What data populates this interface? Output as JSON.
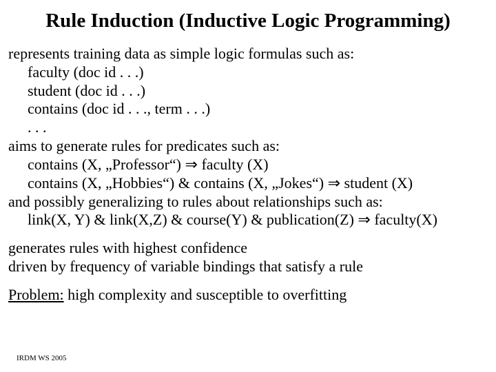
{
  "title": "Rule Induction (Inductive Logic Programming)",
  "l1": "represents training data as simple logic formulas such as:",
  "l2": "faculty (doc id . . .)",
  "l3": "student (doc id . . .)",
  "l4": "contains (doc id . . ., term . . .)",
  "l5": ". . .",
  "l6": "aims to generate rules for predicates such as:",
  "l7a": "contains (X, „Professor“) ",
  "l7b": " faculty (X)",
  "l8a": "contains (X, „Hobbies“) & contains (X, „Jokes“) ",
  "l8b": " student (X)",
  "l9": "and possibly generalizing to rules about relationships such as:",
  "l10a": "link(X, Y) & link(X,Z) & course(Y) & publication(Z) ",
  "l10b": "  faculty(X)",
  "l11": "generates rules with highest confidence",
  "l12": "driven by frequency of variable bindings that satisfy a rule",
  "l13a": "Problem:",
  "l13b": " high complexity and susceptible to overfitting",
  "arrow": "⇒",
  "footer": "IRDM  WS 2005"
}
